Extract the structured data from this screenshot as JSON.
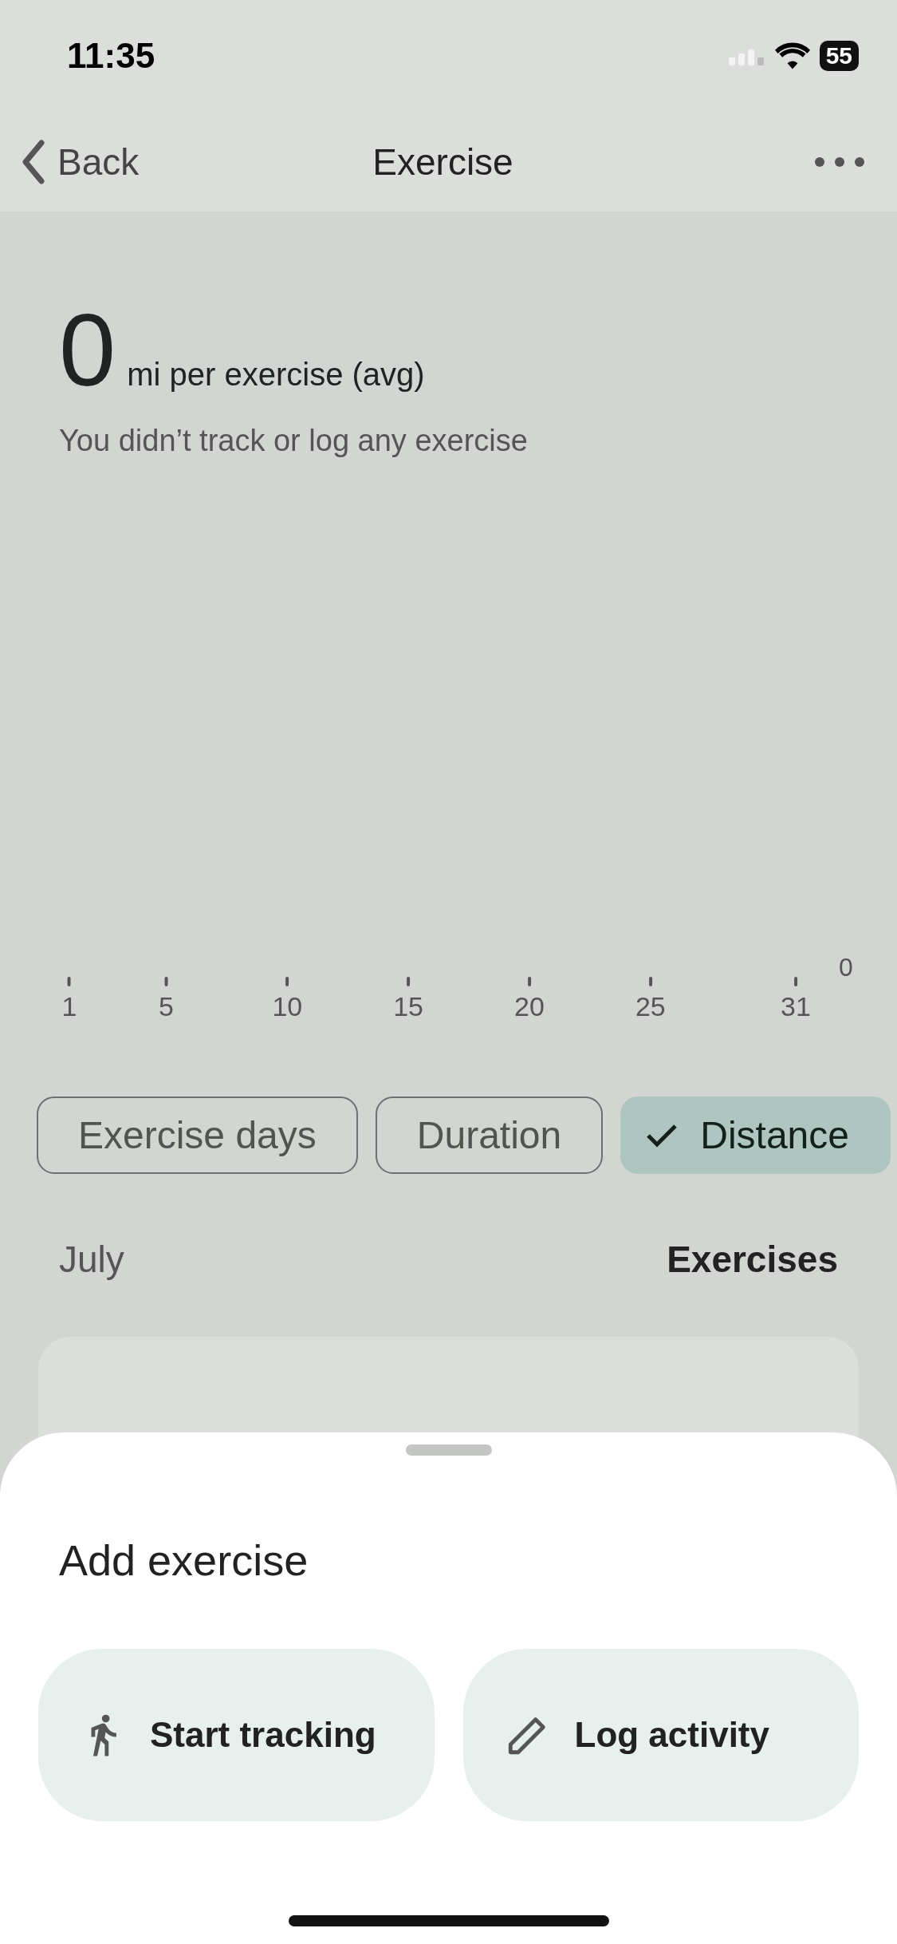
{
  "status_bar": {
    "time": "11:35",
    "battery": "55"
  },
  "nav": {
    "back": "Back",
    "title": "Exercise"
  },
  "summary": {
    "value": "0",
    "unit": "mi per exercise (avg)",
    "note": "You didn’t track or log any exercise"
  },
  "chart": {
    "x_labels": [
      "1",
      "5",
      "10",
      "15",
      "20",
      "25",
      "31"
    ],
    "y_label": "0"
  },
  "chips": [
    {
      "label": "Exercise days",
      "selected": false
    },
    {
      "label": "Duration",
      "selected": false
    },
    {
      "label": "Distance",
      "selected": true
    }
  ],
  "list_header": {
    "month": "July",
    "column": "Exercises"
  },
  "sheet": {
    "title": "Add exercise",
    "actions": [
      {
        "kind": "track",
        "label": "Start tracking"
      },
      {
        "kind": "log",
        "label": "Log activity"
      }
    ]
  }
}
